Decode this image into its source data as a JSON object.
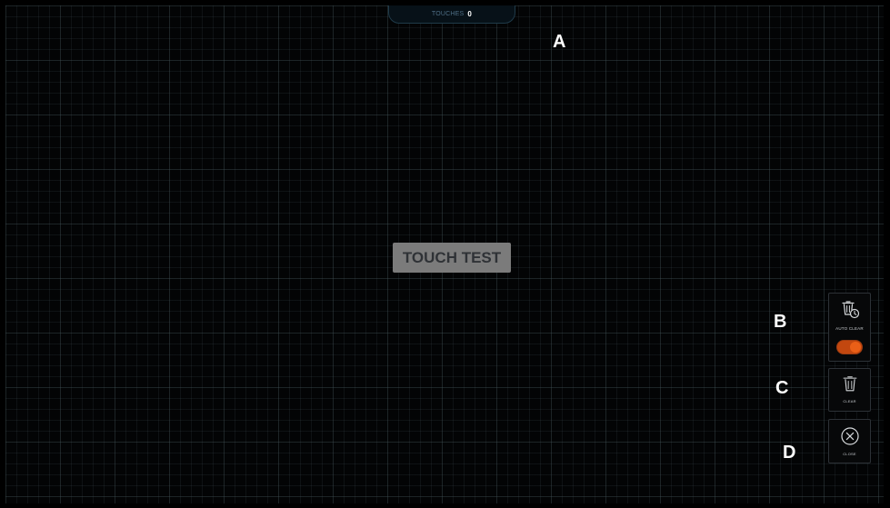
{
  "touch_counter": {
    "label": "TOUCHES",
    "count": "0"
  },
  "center_label": "TOUCH TEST",
  "markers": {
    "a": "A",
    "b": "B",
    "c": "C",
    "d": "D"
  },
  "controls": {
    "auto_clear": {
      "label": "AUTO CLEAR",
      "enabled": true,
      "icon": "trash-clock-icon",
      "accent": "#e05a15"
    },
    "clear": {
      "label": "CLEAR",
      "icon": "trash-icon"
    },
    "close": {
      "label": "CLOSE",
      "icon": "close-circle-icon"
    }
  }
}
